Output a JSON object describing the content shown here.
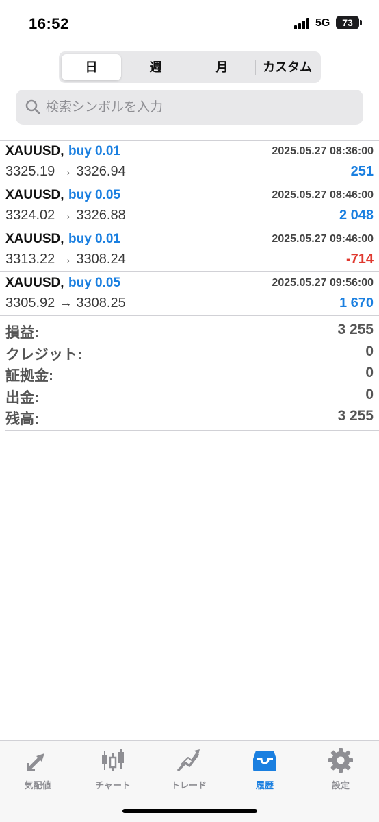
{
  "status": {
    "time": "16:52",
    "network": "5G",
    "battery": "73"
  },
  "segments": [
    {
      "label": "日",
      "active": true
    },
    {
      "label": "週",
      "active": false
    },
    {
      "label": "月",
      "active": false
    },
    {
      "label": "カスタム",
      "active": false
    }
  ],
  "search": {
    "placeholder": "検索シンボルを入力",
    "icon": "search-icon"
  },
  "deals": [
    {
      "symbol": "XAUUSD,",
      "type": "buy 0.01",
      "time": "2025.05.27 08:36:00",
      "prices": "3325.19 → 3326.94",
      "profit": "251",
      "profit_sign": "positive"
    },
    {
      "symbol": "XAUUSD,",
      "type": "buy 0.05",
      "time": "2025.05.27 08:46:00",
      "prices": "3324.02 → 3326.88",
      "profit": "2 048",
      "profit_sign": "positive"
    },
    {
      "symbol": "XAUUSD,",
      "type": "buy 0.01",
      "time": "2025.05.27 09:46:00",
      "prices": "3313.22 → 3308.24",
      "profit": "-714",
      "profit_sign": "negative"
    },
    {
      "symbol": "XAUUSD,",
      "type": "buy 0.05",
      "time": "2025.05.27 09:56:00",
      "prices": "3305.92 → 3308.25",
      "profit": "1 670",
      "profit_sign": "positive"
    }
  ],
  "summary": [
    {
      "label": "損益:",
      "value": "3 255"
    },
    {
      "label": "クレジット:",
      "value": "0"
    },
    {
      "label": "証拠金:",
      "value": "0"
    },
    {
      "label": "出金:",
      "value": "0"
    },
    {
      "label": "残高:",
      "value": "3 255"
    }
  ],
  "tabs": [
    {
      "label": "気配値",
      "icon": "quotes-arrows-icon",
      "active": false
    },
    {
      "label": "チャート",
      "icon": "candlestick-chart-icon",
      "active": false
    },
    {
      "label": "トレード",
      "icon": "trade-trend-icon",
      "active": false
    },
    {
      "label": "履歴",
      "icon": "history-inbox-icon",
      "active": true
    },
    {
      "label": "設定",
      "icon": "settings-gear-icon",
      "active": false
    }
  ],
  "colors": {
    "accent": "#1a7fe0",
    "negative": "#e0382e",
    "inactive": "#8e8e93"
  }
}
